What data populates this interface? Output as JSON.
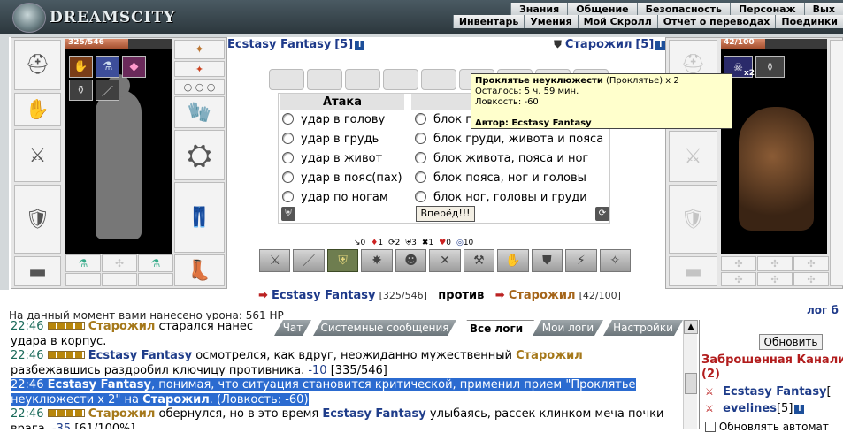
{
  "app": {
    "logo_text": "DREAMSCITY",
    "menu_top": [
      "Знания",
      "Общение",
      "Безопасность",
      "Персонаж",
      "Вых"
    ],
    "menu_bottom": [
      "Инвентарь",
      "Умения",
      "Мой Скролл",
      "Отчет о переводах",
      "Поединки"
    ]
  },
  "player": {
    "name": "Ecstasy Fantasy",
    "level": "[5]",
    "hp_text": "325/546",
    "hp_fraction": 0.595
  },
  "enemy": {
    "name": "Старожил",
    "level": "[5]",
    "hp_text": "42/100",
    "hp_fraction": 0.42,
    "effect_count": "x2"
  },
  "attack": {
    "attack_header": "Атака",
    "attack_options": [
      "удар в голову",
      "удар в грудь",
      "удар в живот",
      "удар в пояс(пах)",
      "удар по ногам"
    ],
    "block_options": [
      "блок г",
      "блок груди, живота и пояса",
      "блок живота, пояса и ног",
      "блок пояса, ног и головы",
      "блок ног, головы и груди"
    ],
    "go_button": "Вперёд!!!"
  },
  "tooltip": {
    "title": "Проклятье неуклюжести",
    "subtitle": "(Проклятье) x 2",
    "remaining": "Осталось: 5 ч. 59 мин.",
    "effect": "Ловкость: -60",
    "author": "Автор: Ecstasy Fantasy"
  },
  "stats": [
    {
      "icon": "↘",
      "value": "0"
    },
    {
      "icon": "♦",
      "value": "1"
    },
    {
      "icon": "⟳",
      "value": "2"
    },
    {
      "icon": "⛨",
      "value": "3"
    },
    {
      "icon": "✖",
      "value": "1"
    },
    {
      "icon": "♥",
      "value": "0"
    },
    {
      "icon": "◎",
      "value": "10"
    }
  ],
  "versus": {
    "player_name": "Ecstasy Fantasy",
    "player_hp": "[325/546]",
    "word": "против",
    "enemy_name": "Старожил",
    "enemy_hp": "[42/100]"
  },
  "log_link": "лог б",
  "damage_line": "На данный момент вами нанесено урона: 561 HP",
  "tabs": [
    "Чат",
    "Системные сообщения",
    "Все логи",
    "Мои логи",
    "Настройки"
  ],
  "active_tab": "Все логи",
  "log": {
    "l0a": "22:46",
    "l0b": "Старожил",
    "l0c": "старался нанес",
    "l1": "удара в корпус.",
    "l2a": "22:46",
    "l2b": "Ecstasy Fantasy",
    "l2c": "осмотрелся, как вдруг, неожиданно мужественный",
    "l2d": "Старожил",
    "l3a": "разбежавшись раздробил ключицу противника.",
    "l3b": "-10",
    "l3c": "[335/546]",
    "l4a": "22:46",
    "l4b": "Ecstasy Fantasy",
    "l4c": ", понимая, что ситуация становится критической, применил прием \"Проклятье",
    "l5a": "неуклюжести x 2\" на",
    "l5b": "Старожил",
    "l5c": ". (Ловкость: -60)",
    "l6a": "22:46",
    "l6b": "Старожил",
    "l6c": "обернулся, но в это время",
    "l6d": "Ecstasy Fantasy",
    "l6e": "улыбаясь, рассек клинком меча почки",
    "l7a": "врага.",
    "l7b": "-35",
    "l7c": "[61/100%]"
  },
  "right": {
    "refresh": "Обновить",
    "room": "Заброшенная Канали",
    "room_count": "(2)",
    "members": [
      {
        "name": "Ecstasy Fantasy",
        "suffix": "["
      },
      {
        "name": "evelines",
        "suffix": "[5]"
      }
    ],
    "checkbox_label": "Обновлять автомат"
  }
}
